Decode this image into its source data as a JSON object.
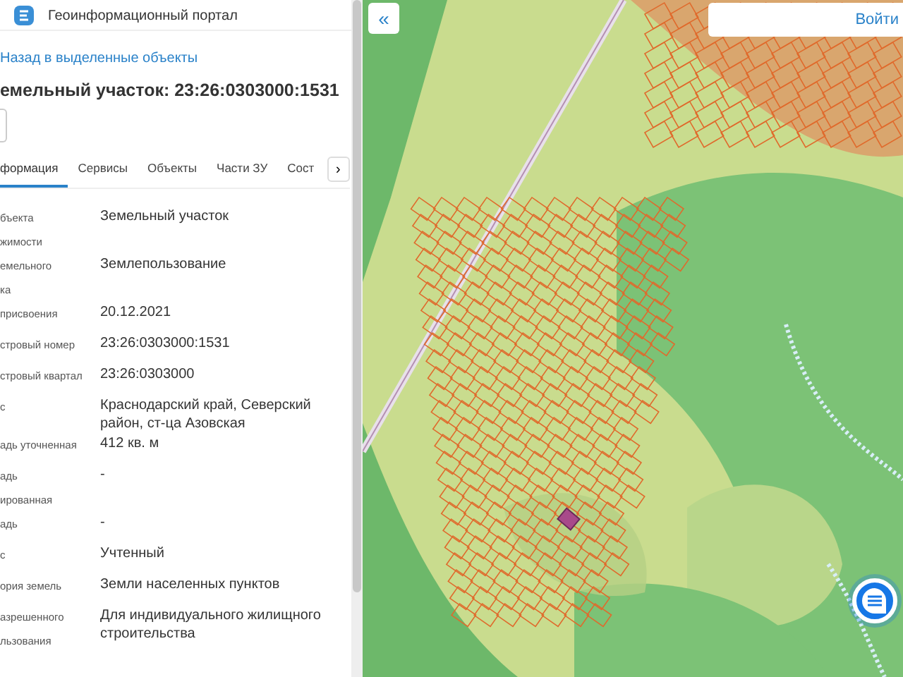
{
  "header": {
    "title": "Геоинформационный портал"
  },
  "back_link": "Назад в выделенные объекты",
  "object_title": "емельный участок: 23:26:0303000:1531",
  "tabs": [
    {
      "label": "формация",
      "selected": true
    },
    {
      "label": "Сервисы",
      "selected": false
    },
    {
      "label": "Объекты",
      "selected": false
    },
    {
      "label": "Части ЗУ",
      "selected": false
    },
    {
      "label": "Сост",
      "selected": false
    }
  ],
  "tabs_scroll_button": "›",
  "properties": [
    {
      "label": "бъекта\nжимости",
      "value": "Земельный участок"
    },
    {
      "label": "емельного\nка",
      "value": "Землепользование"
    },
    {
      "label": "присвоения",
      "value": "20.12.2021"
    },
    {
      "label": "стровый номер",
      "value": "23:26:0303000:1531"
    },
    {
      "label": "стровый квартал",
      "value": "23:26:0303000"
    },
    {
      "label": "с",
      "value": "Краснодарский край, Северский район, ст-ца Азовская"
    },
    {
      "label": "адь уточненная",
      "value": "412 кв. м"
    },
    {
      "label": "адь\nированная",
      "value": "-"
    },
    {
      "label": "адь",
      "value": "-"
    },
    {
      "label": "с",
      "value": "Учтенный"
    },
    {
      "label": "ория земель",
      "value": "Земли населенных пунктов"
    },
    {
      "label": "азрешенного\nльзования",
      "value": "Для индивидуального жилищного строительства"
    }
  ],
  "map": {
    "collapse_button": "«",
    "login_button": "Войти"
  }
}
